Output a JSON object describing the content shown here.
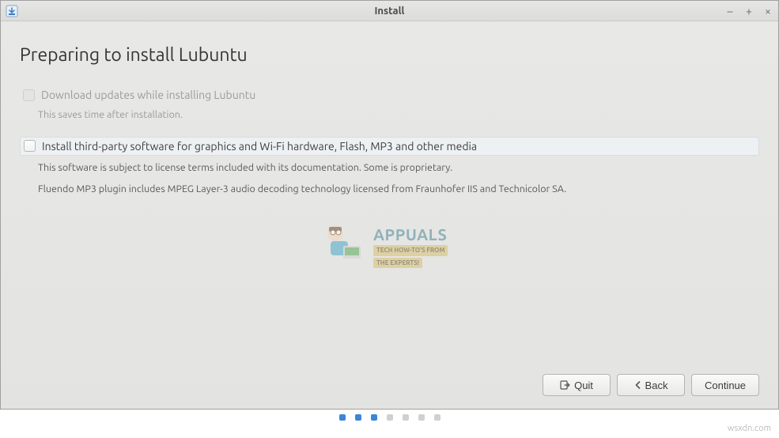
{
  "window": {
    "title": "Install"
  },
  "heading": "Preparing to install Lubuntu",
  "option_updates": {
    "label": "Download updates while installing Lubuntu",
    "desc": "This saves time after installation."
  },
  "option_thirdparty": {
    "label": "Install third-party software for graphics and Wi-Fi hardware, Flash, MP3 and other media",
    "desc1": "This software is subject to license terms included with its documentation. Some is proprietary.",
    "desc2": "Fluendo MP3 plugin includes MPEG Layer-3 audio decoding technology licensed from Fraunhofer IIS and Technicolor SA."
  },
  "buttons": {
    "quit": "Quit",
    "back": "Back",
    "continue": "Continue"
  },
  "watermark": {
    "brand": "APPUALS",
    "tagline1": "TECH HOW-TO'S FROM",
    "tagline2": "THE EXPERTS!"
  },
  "progress": {
    "total": 7,
    "active": 3
  },
  "source": "wsxdn.com"
}
